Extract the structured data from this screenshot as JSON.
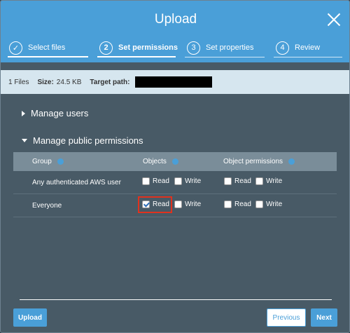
{
  "dialog": {
    "title": "Upload"
  },
  "steps": [
    {
      "number": "",
      "label": "Select files",
      "state": "complete"
    },
    {
      "number": "2",
      "label": "Set permissions",
      "state": "active"
    },
    {
      "number": "3",
      "label": "Set properties",
      "state": "inactive"
    },
    {
      "number": "4",
      "label": "Review",
      "state": "inactive"
    }
  ],
  "info": {
    "files": "1 Files",
    "size_label": "Size:",
    "size_value": "24.5 KB",
    "target_label": "Target path:"
  },
  "sections": {
    "manage_users": "Manage users",
    "manage_public": "Manage public permissions"
  },
  "table": {
    "headers": {
      "group": "Group",
      "objects": "Objects",
      "object_permissions": "Object permissions"
    },
    "rows": [
      {
        "group": "Any authenticated AWS user",
        "obj_read": "Read",
        "obj_write": "Write",
        "perm_read": "Read",
        "perm_write": "Write",
        "obj_read_checked": false
      },
      {
        "group": "Everyone",
        "obj_read": "Read",
        "obj_write": "Write",
        "perm_read": "Read",
        "perm_write": "Write",
        "obj_read_checked": true
      }
    ]
  },
  "buttons": {
    "upload": "Upload",
    "previous": "Previous",
    "next": "Next"
  },
  "colors": {
    "header": "#4a9fd8",
    "body": "#485a66",
    "highlight": "#e0321e"
  }
}
